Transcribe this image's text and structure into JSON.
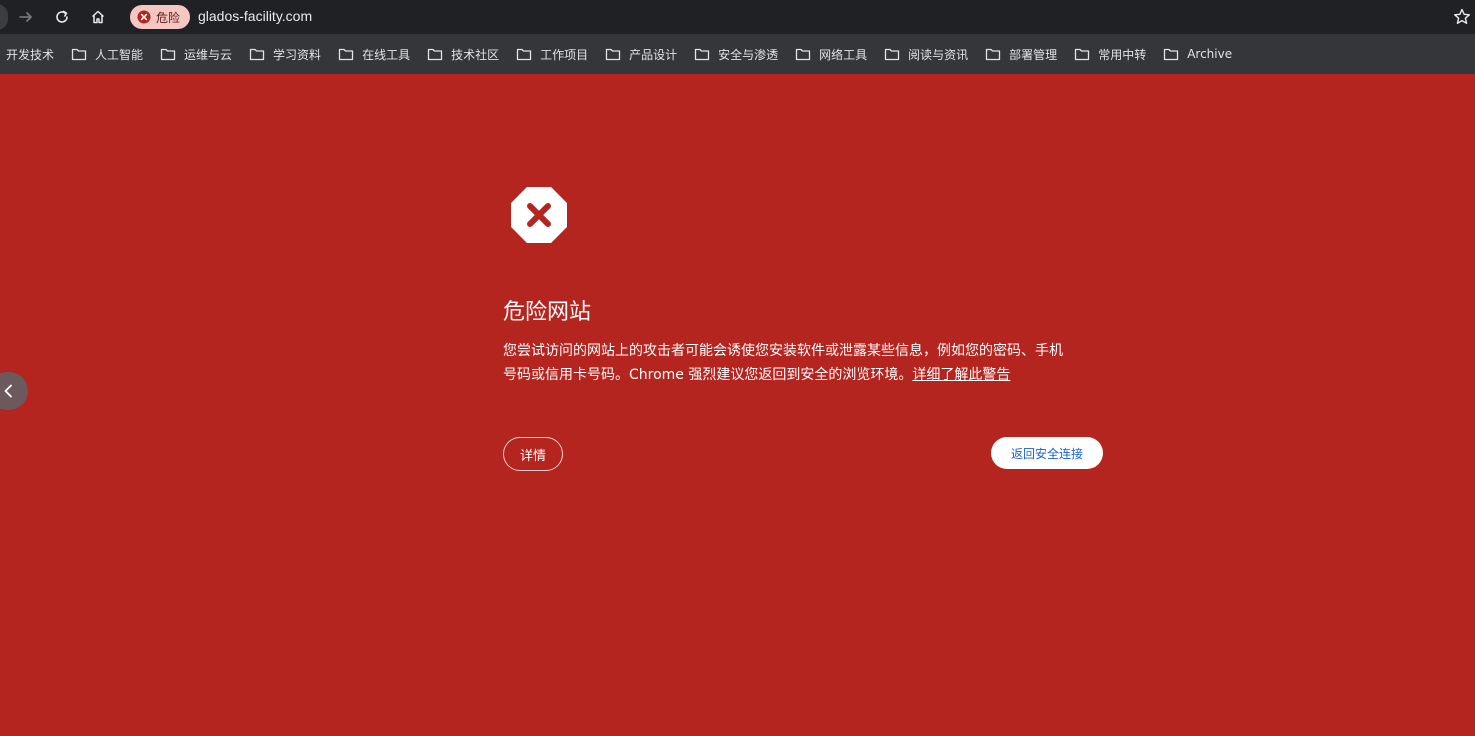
{
  "browser": {
    "security_chip": "危险",
    "url": "glados-facility.com"
  },
  "bookmarks": [
    {
      "label": "开发技术",
      "icon": "none"
    },
    {
      "label": "人工智能",
      "icon": "folder-icon"
    },
    {
      "label": "运维与云",
      "icon": "folder-icon"
    },
    {
      "label": "学习资料",
      "icon": "folder-icon"
    },
    {
      "label": "在线工具",
      "icon": "folder-icon"
    },
    {
      "label": "技术社区",
      "icon": "folder-icon"
    },
    {
      "label": "工作项目",
      "icon": "folder-icon"
    },
    {
      "label": "产品设计",
      "icon": "folder-icon"
    },
    {
      "label": "安全与渗透",
      "icon": "folder-icon"
    },
    {
      "label": "网络工具",
      "icon": "folder-icon"
    },
    {
      "label": "阅读与资讯",
      "icon": "folder-icon"
    },
    {
      "label": "部署管理",
      "icon": "folder-icon"
    },
    {
      "label": "常用中转",
      "icon": "folder-icon"
    },
    {
      "label": "Archive",
      "icon": "folder-icon"
    }
  ],
  "interstitial": {
    "title": "危险网站",
    "body_line1": "您尝试访问的网站上的攻击者可能会诱使您安装软件或泄露某些信息，例如您的密码、手机",
    "body_line2": "号码或信用卡号码。Chrome 强烈建议您返回到安全的浏览环境。",
    "learn_more_link": "详细了解此警告",
    "details_button": "详情",
    "back_button": "返回安全连接"
  },
  "colors": {
    "background": "#b42520",
    "toolbar": "#202124",
    "bookmarks_bar": "#35363a",
    "chip": "#f5c7c3",
    "back_button_text": "#1a62c9"
  }
}
